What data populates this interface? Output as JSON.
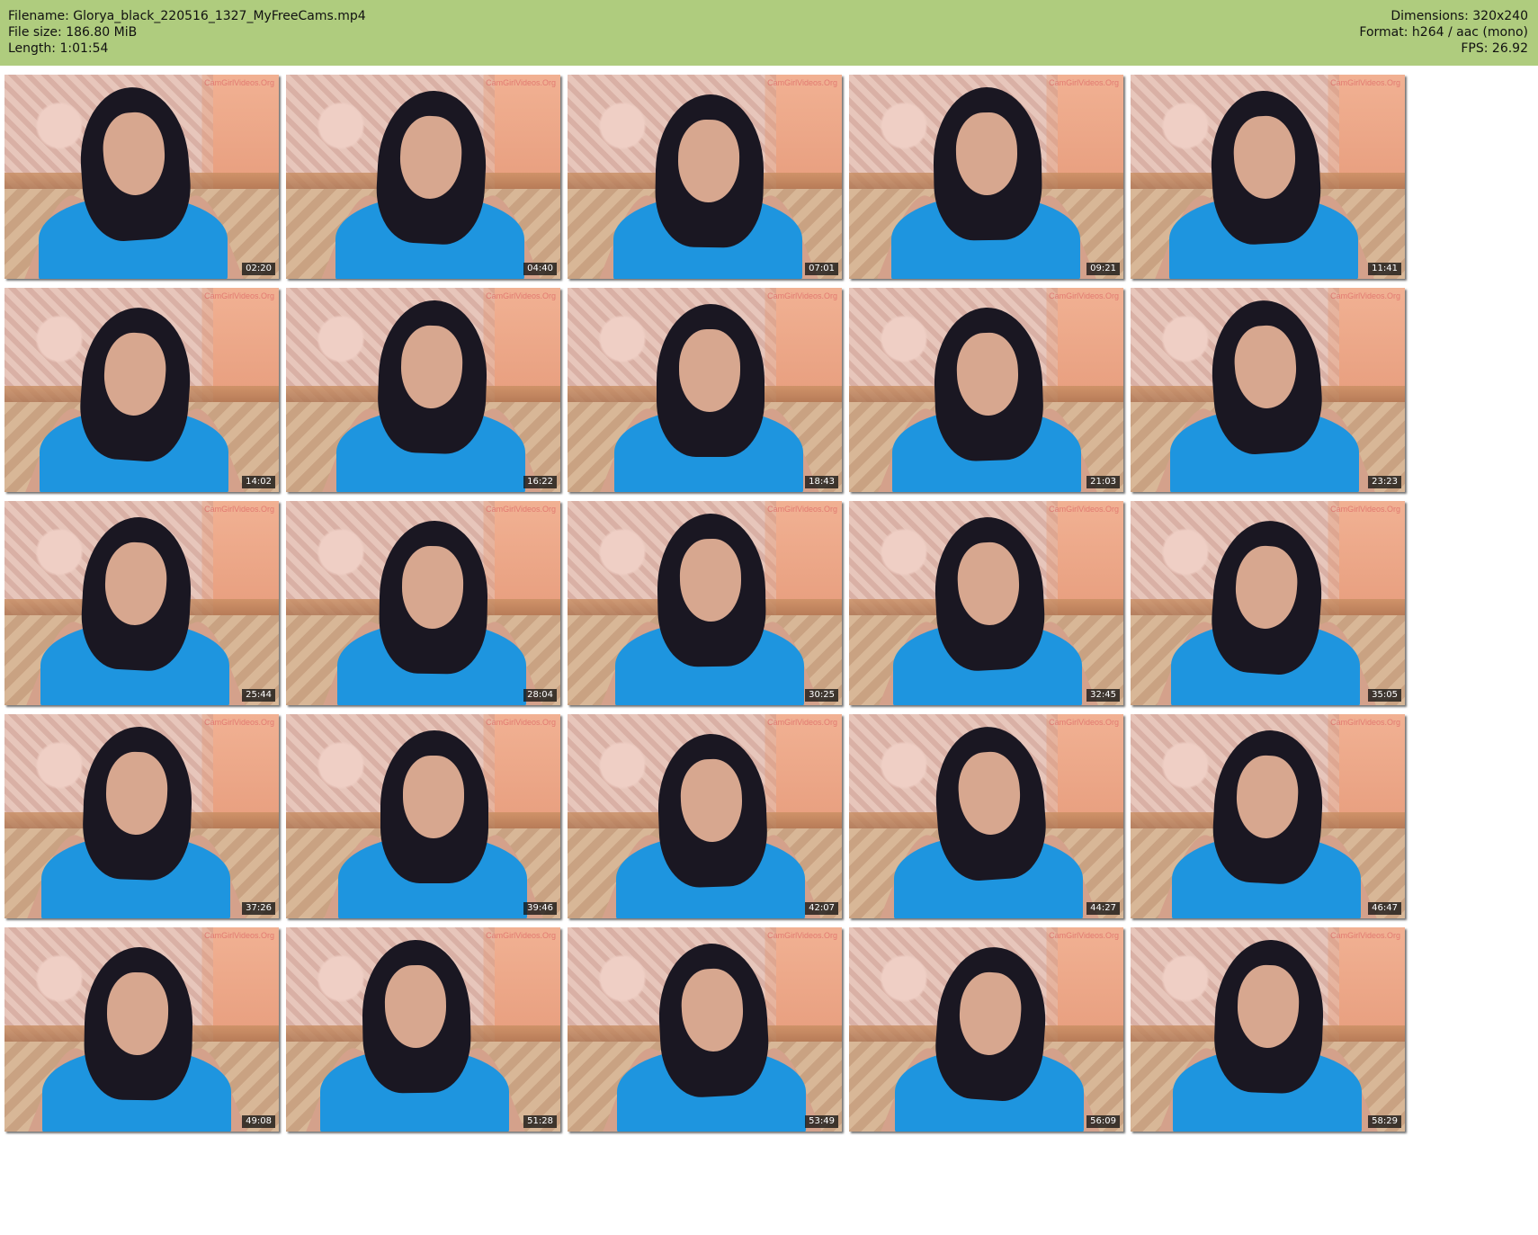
{
  "header": {
    "filename_label": "Filename: Glorya_black_220516_1327_MyFreeCams.mp4",
    "filesize_label": "File size: 186.80 MiB",
    "length_label": "Length: 1:01:54",
    "dimensions_label": "Dimensions: 320x240",
    "format_label": "Format: h264 / aac (mono)",
    "fps_label": "FPS: 26.92"
  },
  "thumbnails": [
    {
      "time": "02:20",
      "watermark": "CamGirlVideos.Org"
    },
    {
      "time": "04:40",
      "watermark": "CamGirlVideos.Org"
    },
    {
      "time": "07:01",
      "watermark": "CamGirlVideos.Org"
    },
    {
      "time": "09:21",
      "watermark": "CamGirlVideos.Org"
    },
    {
      "time": "11:41",
      "watermark": "CamGirlVideos.Org"
    },
    {
      "time": "14:02",
      "watermark": "CamGirlVideos.Org"
    },
    {
      "time": "16:22",
      "watermark": "CamGirlVideos.Org"
    },
    {
      "time": "18:43",
      "watermark": "CamGirlVideos.Org"
    },
    {
      "time": "21:03",
      "watermark": "CamGirlVideos.Org"
    },
    {
      "time": "23:23",
      "watermark": "CamGirlVideos.Org"
    },
    {
      "time": "25:44",
      "watermark": "CamGirlVideos.Org"
    },
    {
      "time": "28:04",
      "watermark": "CamGirlVideos.Org"
    },
    {
      "time": "30:25",
      "watermark": "CamGirlVideos.Org"
    },
    {
      "time": "32:45",
      "watermark": "CamGirlVideos.Org"
    },
    {
      "time": "35:05",
      "watermark": "CamGirlVideos.Org"
    },
    {
      "time": "37:26",
      "watermark": "CamGirlVideos.Org"
    },
    {
      "time": "39:46",
      "watermark": "CamGirlVideos.Org"
    },
    {
      "time": "42:07",
      "watermark": "CamGirlVideos.Org"
    },
    {
      "time": "44:27",
      "watermark": "CamGirlVideos.Org"
    },
    {
      "time": "46:47",
      "watermark": "CamGirlVideos.Org"
    },
    {
      "time": "49:08",
      "watermark": "CamGirlVideos.Org"
    },
    {
      "time": "51:28",
      "watermark": "CamGirlVideos.Org"
    },
    {
      "time": "53:49",
      "watermark": "CamGirlVideos.Org"
    },
    {
      "time": "56:09",
      "watermark": "CamGirlVideos.Org"
    },
    {
      "time": "58:29",
      "watermark": "CamGirlVideos.Org"
    }
  ],
  "colors": {
    "header_bg": "#afcc7e",
    "shirt": "#1e95df",
    "hair": "#1a1722"
  }
}
